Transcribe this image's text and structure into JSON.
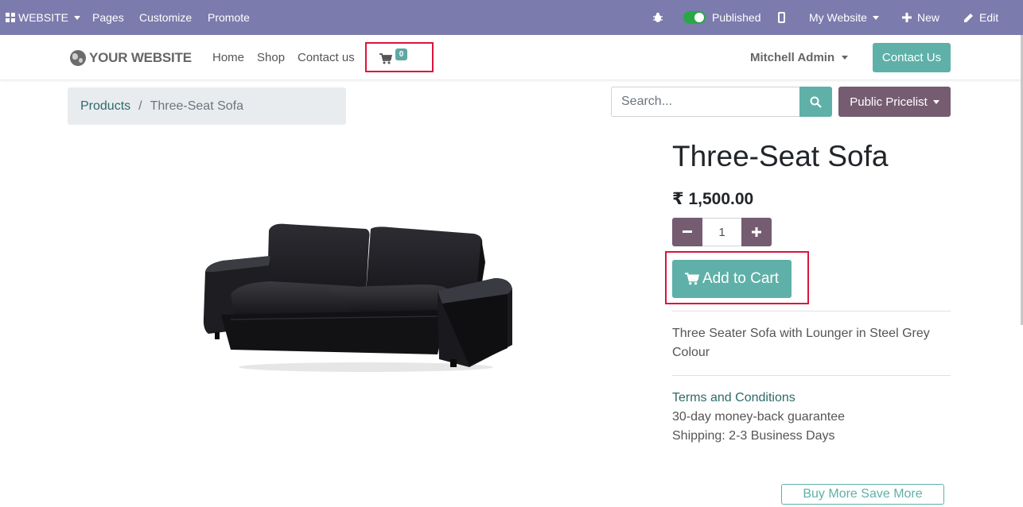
{
  "admin_bar": {
    "website_menu": "WEBSITE",
    "pages": "Pages",
    "customize": "Customize",
    "promote": "Promote",
    "published": "Published",
    "my_website": "My Website",
    "new": "New",
    "edit": "Edit"
  },
  "header": {
    "logo_text": "YOUR WEBSITE",
    "nav": [
      "Home",
      "Shop",
      "Contact us"
    ],
    "cart_count": "0",
    "user": "Mitchell Admin",
    "contact_button": "Contact Us"
  },
  "breadcrumb": {
    "parent": "Products",
    "separator": "/",
    "current": "Three-Seat Sofa"
  },
  "search": {
    "placeholder": "Search..."
  },
  "pricelist": {
    "label": "Public Pricelist"
  },
  "product": {
    "name": "Three-Seat Sofa",
    "price": "₹ 1,500.00",
    "quantity": "1",
    "add_to_cart": "Add to Cart",
    "description_line1": "Three Seater Sofa with Lounger in Steel Grey",
    "description_line2": "Colour",
    "terms_link": "Terms and Conditions",
    "guarantee": "30-day money-back guarantee",
    "shipping": "Shipping: 2-3 Business Days",
    "buy_more": "Buy More Save More"
  },
  "colors": {
    "admin_bar": "#7c7bad",
    "primary": "#5fb0a8",
    "secondary": "#755c71",
    "highlight": "#dc143c"
  }
}
